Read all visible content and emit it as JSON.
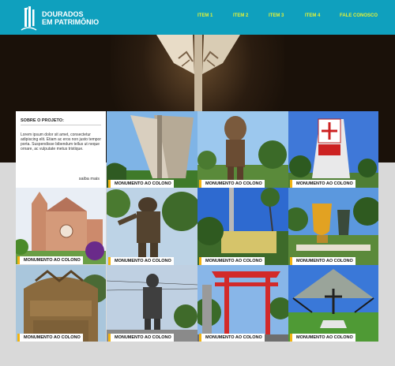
{
  "header": {
    "brand_line1": "DOURADOS",
    "brand_line2": "EM PATRIMÔNIO",
    "logo_icon": "monument-logo-icon",
    "bg_color": "#0fa0be",
    "nav_color": "#e4f236",
    "nav": [
      "ITEM 1",
      "ITEM 2",
      "ITEM 3",
      "ITEM 4",
      "FALE CONOSCO"
    ]
  },
  "intro": {
    "title": "SOBRE O PROJETO:",
    "text": "Lorem ipsum dolor sit amet, consectetur adipiscing elit. Etiam ac eros non justo tempor porta. Suspendisse bibendum tellus ut neque ornare, ac vulputate metus tristique.",
    "more": "saiba mais"
  },
  "tiles": [
    {
      "caption": "MONUMENTO AO COLONO"
    },
    {
      "caption": "MONUMENTO AO COLONO"
    },
    {
      "caption": "MONUMENTO AO COLONO"
    },
    {
      "caption": "MONUMENTO AO COLONO"
    },
    {
      "caption": "MONUMENTO AO COLONO"
    },
    {
      "caption": "MONUMENTO AO COLONO"
    },
    {
      "caption": "MONUMENTO AO COLONO"
    },
    {
      "caption": "MONUMENTO AO COLONO"
    },
    {
      "caption": "MONUMENTO AO COLONO"
    },
    {
      "caption": "MONUMENTO AO COLONO"
    },
    {
      "caption": "MONUMENTO AO COLONO"
    }
  ],
  "caption_accent": "#f2b311"
}
